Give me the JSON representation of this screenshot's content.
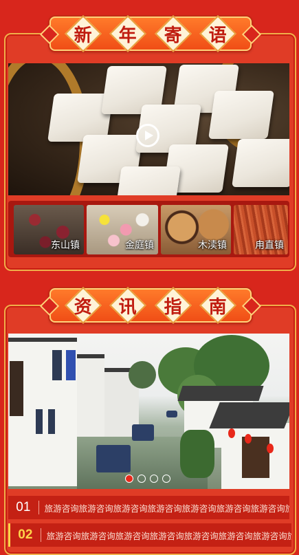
{
  "banners": {
    "section1": [
      "新",
      "年",
      "寄",
      "语"
    ],
    "section2": [
      "资",
      "讯",
      "指",
      "南"
    ]
  },
  "video": {
    "play_icon": "play-icon"
  },
  "towns": [
    {
      "label": "东山镇"
    },
    {
      "label": "金庭镇"
    },
    {
      "label": "木渎镇"
    },
    {
      "label": "甪直镇"
    }
  ],
  "carousel": {
    "dot_count": 4,
    "active_index": 0
  },
  "news": [
    {
      "num": "01",
      "text": "旅游咨询旅游咨询旅游咨询旅游咨询旅游咨询旅游咨询旅游咨询旅游"
    },
    {
      "num": "02",
      "text": "旅游咨询旅游咨询旅游咨询旅游咨询旅游咨询旅游咨询旅游咨询旅游"
    }
  ],
  "colors": {
    "background": "#d8261c",
    "banner": "#f04e16",
    "accent_gold": "#ffd54a",
    "active_dot": "#e8281a"
  }
}
